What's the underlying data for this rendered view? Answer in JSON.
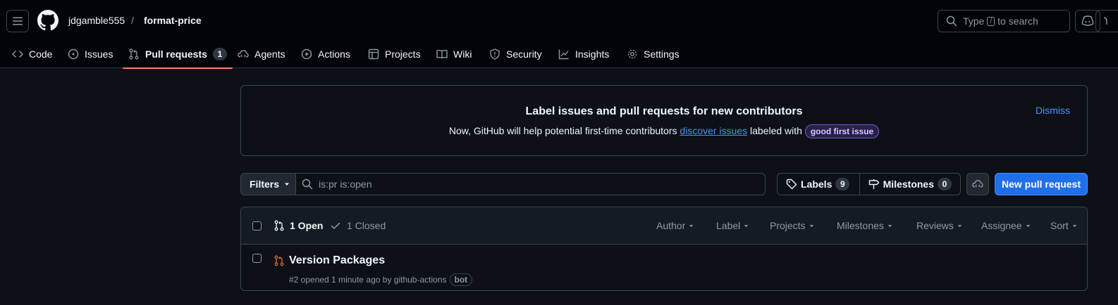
{
  "header": {
    "owner": "jdgamble555",
    "separator": "/",
    "repo": "format-price",
    "search": {
      "prefix": "Type",
      "key": "/",
      "suffix": "to search"
    }
  },
  "tabs": [
    {
      "label": "Code",
      "icon": "code-icon"
    },
    {
      "label": "Issues",
      "icon": "issue-opened-icon"
    },
    {
      "label": "Pull requests",
      "icon": "git-pull-request-icon",
      "count": "1",
      "active": true
    },
    {
      "label": "Agents",
      "icon": "cloud-agent-icon"
    },
    {
      "label": "Actions",
      "icon": "play-icon"
    },
    {
      "label": "Projects",
      "icon": "table-icon"
    },
    {
      "label": "Wiki",
      "icon": "book-icon"
    },
    {
      "label": "Security",
      "icon": "shield-icon"
    },
    {
      "label": "Insights",
      "icon": "graph-icon"
    },
    {
      "label": "Settings",
      "icon": "gear-icon"
    }
  ],
  "banner": {
    "title": "Label issues and pull requests for new contributors",
    "text_before": "Now, GitHub will help potential first-time contributors",
    "link": "discover issues",
    "text_after": "labeled with",
    "label": "good first issue",
    "dismiss": "Dismiss"
  },
  "filterbar": {
    "filters_label": "Filters",
    "query": "is:pr is:open",
    "labels_label": "Labels",
    "labels_count": "9",
    "milestones_label": "Milestones",
    "milestones_count": "0",
    "new_pr_label": "New pull request"
  },
  "list": {
    "open_label": "1 Open",
    "closed_label": "1 Closed",
    "columns": [
      "Author",
      "Label",
      "Projects",
      "Milestones",
      "Reviews",
      "Assignee",
      "Sort"
    ],
    "items": [
      {
        "title": "Version Packages",
        "meta": "#2 opened 1 minute ago by github-actions",
        "badge": "bot"
      }
    ]
  },
  "colors": {
    "background": "#0d1117",
    "header_bg": "#010409",
    "accent_blue": "#1f6feb",
    "active_underline": "#f78166",
    "pr_open_icon": "#db6d28"
  }
}
